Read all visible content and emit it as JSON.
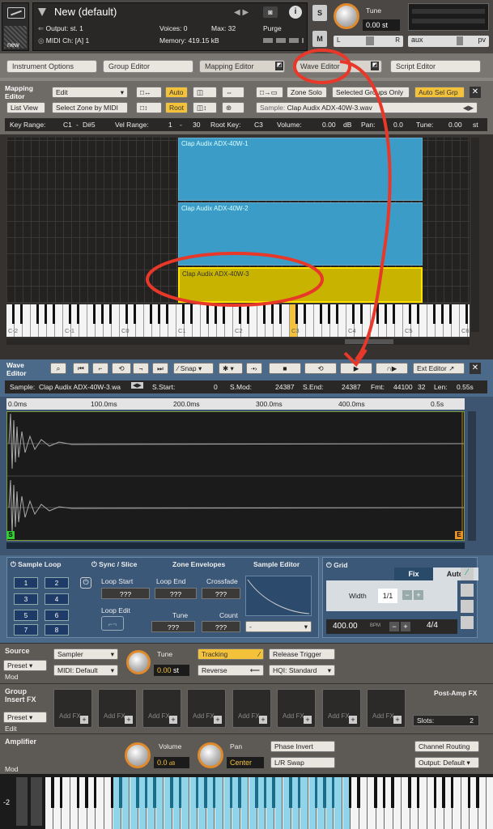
{
  "header": {
    "title": "New (default)",
    "output_label": "Output:",
    "output_value": "st. 1",
    "midi_label": "MIDI Ch:",
    "midi_value": "[A] 1",
    "voices_label": "Voices:",
    "voices_value": "0",
    "max_label": "Max:",
    "max_value": "32",
    "purge": "Purge",
    "memory_label": "Memory:",
    "memory_value": "419.15 kB",
    "tune_label": "Tune",
    "tune_value": "0.00",
    "tune_unit": "st",
    "s_btn": "S",
    "m_btn": "M",
    "l_label": "L",
    "r_label": "R",
    "aux": "aux",
    "pv": "pv",
    "new_label": "new"
  },
  "tabs": [
    "Instrument Options",
    "Group Editor",
    "Mapping Editor",
    "Wave Editor",
    "Script Editor"
  ],
  "mapping": {
    "title_line1": "Mapping",
    "title_line2": "Editor",
    "edit": "Edit",
    "auto": "Auto",
    "root": "Root",
    "list_view": "List View",
    "select_zone_by_midi": "Select Zone by MIDI",
    "zone_solo": "Zone Solo",
    "selected_groups_only": "Selected Groups Only",
    "auto_sel_grp": "Auto Sel Grp",
    "sample_label": "Sample:",
    "sample_value": "Clap Audix ADX-40W-3.wav",
    "key_range_label": "Key Range:",
    "key_range_from": "C1",
    "key_range_to": "D#5",
    "vel_range_label": "Vel Range:",
    "vel_from": "1",
    "vel_to": "30",
    "root_key_label": "Root Key:",
    "root_key_value": "C3",
    "volume_label": "Volume:",
    "volume_value": "0.00",
    "volume_unit": "dB",
    "pan_label": "Pan:",
    "pan_value": "0.0",
    "tune_label": "Tune:",
    "tune_value": "0.00",
    "tune_unit": "st",
    "zones": [
      "Clap Audix ADX-40W-1",
      "Clap Audix ADX-40W-2",
      "Clap Audix ADX-40W-3"
    ],
    "octaves": [
      "C-2",
      "C-1",
      "C0",
      "C1",
      "C2",
      "C3",
      "C4",
      "C5",
      "C6"
    ]
  },
  "wave": {
    "title_line1": "Wave",
    "title_line2": "Editor",
    "snap": "Snap",
    "ext_editor": "Ext Editor",
    "sample_label": "Sample:",
    "sample_value": "Clap Audix ADX-40W-3.wa",
    "s_start_label": "S.Start:",
    "s_start_value": "0",
    "s_mod_label": "S.Mod:",
    "s_mod_value": "24387",
    "s_end_label": "S.End:",
    "s_end_value": "24387",
    "fmt_label": "Fmt:",
    "fmt_value": "44100",
    "fmt_bits": "32",
    "len_label": "Len:",
    "len_value": "0.55s",
    "time_ticks": [
      "0.0ms",
      "100.0ms",
      "200.0ms",
      "300.0ms",
      "400.0ms",
      "0.5s"
    ],
    "s_marker": "S",
    "e_marker": "E"
  },
  "bottom_tabs": {
    "sample_loop": "Sample Loop",
    "sync_slice": "Sync / Slice",
    "zone_envelopes": "Zone Envelopes",
    "sample_editor": "Sample Editor",
    "grid": "Grid",
    "fix": "Fix",
    "auto": "Auto"
  },
  "loop": {
    "numbers": [
      "1",
      "2",
      "3",
      "4",
      "5",
      "6",
      "7",
      "8"
    ],
    "loop_start": "Loop Start",
    "loop_end": "Loop End",
    "crossfade": "Crossfade",
    "loop_edit": "Loop Edit",
    "tune": "Tune",
    "count": "Count",
    "qqq": "???",
    "dash": "-"
  },
  "grid": {
    "width_label": "Width",
    "fraction": "1/1",
    "bpm_value": "400.00",
    "bpm_unit": "BPM",
    "meter": "4/4"
  },
  "source": {
    "title": "Source",
    "preset": "Preset",
    "mod": "Mod",
    "sampler": "Sampler",
    "midi_default": "MIDI: Default",
    "tune_label": "Tune",
    "tune_value": "0.00",
    "tune_unit": "st",
    "tracking": "Tracking",
    "reverse": "Reverse",
    "release_trigger": "Release Trigger",
    "hqi": "HQI: Standard"
  },
  "insert": {
    "title_line1": "Group",
    "title_line2": "Insert FX",
    "preset": "Preset",
    "edit": "Edit",
    "add_fx": "Add FX",
    "post_amp": "Post-Amp FX",
    "slots_label": "Slots:",
    "slots_value": "2"
  },
  "amp": {
    "title": "Amplifier",
    "mod": "Mod",
    "volume_label": "Volume",
    "volume_value": "0.0",
    "volume_unit": "dB",
    "pan_label": "Pan",
    "pan_value": "Center",
    "phase_invert": "Phase Invert",
    "lr_swap": "L/R Swap",
    "channel_routing": "Channel Routing",
    "output_default": "Output: Default"
  },
  "keyboard_label": "-2",
  "colors": {
    "accent": "#f3c23a",
    "zone_blue": "#3a9cc7",
    "zone_yellow": "#c8b400",
    "annotation": "#e8382a",
    "keyboard_highlight": "#8fd4e8"
  }
}
